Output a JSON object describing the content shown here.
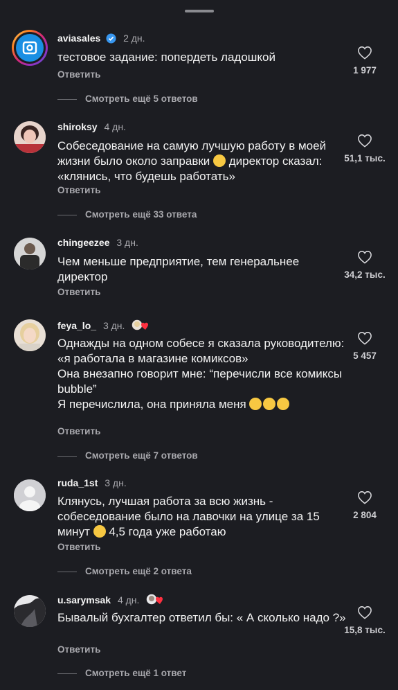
{
  "reply_label": "Ответить",
  "comments": [
    {
      "username": "aviasales",
      "time": "2 дн.",
      "text": "тестовое задание: попердеть ладошкой",
      "likes": "1 977",
      "more": "Смотреть ещё 5 ответов",
      "verified": true
    },
    {
      "username": "shiroksy",
      "time": "4 дн.",
      "text_before": "Собеседование на самую лучшую работу в моей жизни было около заправки",
      "text_after": "директор сказал: «клянись, что будешь работать»",
      "likes": "51,1 тыс.",
      "more": "Смотреть ещё 33 ответа"
    },
    {
      "username": "chingeezee",
      "time": "3 дн.",
      "text": "Чем меньше предприятие, тем генеральнее директор",
      "likes": "34,2 тыс."
    },
    {
      "username": "feya_lo_",
      "time": "3 дн.",
      "text_lines": [
        "Однажды на одном собесе я сказала руководителю: «я работала в магазине комиксов»",
        "Она внезапно говорит мне: “перечисли все комиксы bubble”",
        "Я перечислила, она приняла меня"
      ],
      "likes": "5 457",
      "more": "Смотреть ещё 7 ответов",
      "liked_by_author": true
    },
    {
      "username": "ruda_1st",
      "time": "3 дн.",
      "text_before": "Клянусь, лучшая работа за всю жизнь - собеседование было на лавочки на улице за 15 минут",
      "text_after": "4,5 года уже работаю",
      "likes": "2 804",
      "more": "Смотреть ещё 2 ответа"
    },
    {
      "username": "u.sarymsak",
      "time": "4 дн.",
      "text": "Бывалый бухгалтер ответил бы: « А сколько надо ?»",
      "likes": "15,8 тыс.",
      "more": "Смотреть ещё 1 ответ",
      "liked_by_author": true
    }
  ],
  "colors": {
    "background": "#1c1d22",
    "secondary_text": "#a8a8ad",
    "verified": "#3897f0",
    "heart_red": "#ff3040"
  },
  "icons": [
    "heart-icon",
    "verified-badge-icon",
    "emoji-icon"
  ]
}
